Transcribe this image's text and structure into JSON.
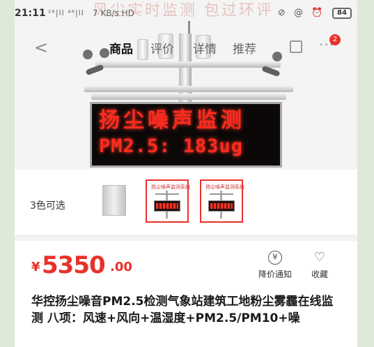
{
  "status_bar": {
    "time": "21:11",
    "network": "²⁶|ll ⁴⁶|ll",
    "speed": "7 KB/s HD",
    "icons": "⊘ @ ⏰",
    "battery": "84"
  },
  "hero": {
    "overlay_text": "风尘实时监测 包过环评",
    "led_line1": "扬尘噪声监测",
    "led_line2": "PM2.5: 183ug"
  },
  "nav": {
    "tabs": [
      {
        "label": "商品",
        "active": true
      },
      {
        "label": "评价",
        "active": false
      },
      {
        "label": "详情",
        "active": false
      },
      {
        "label": "推荐",
        "active": false
      }
    ],
    "more_badge": "2"
  },
  "variants": {
    "label": "3色可选",
    "thumb_title": "扬尘噪声监测系统"
  },
  "price": {
    "currency": "¥",
    "integer": "5350",
    "decimal": ".00",
    "accent_color": "#e8312a"
  },
  "actions": {
    "price_alert": "降价通知",
    "favorite": "收藏"
  },
  "product": {
    "title": "华控扬尘噪音PM2.5检测气象站建筑工地粉尘雾霾在线监测 八项：风速+风向+温湿度+PM2.5/PM10+噪"
  }
}
